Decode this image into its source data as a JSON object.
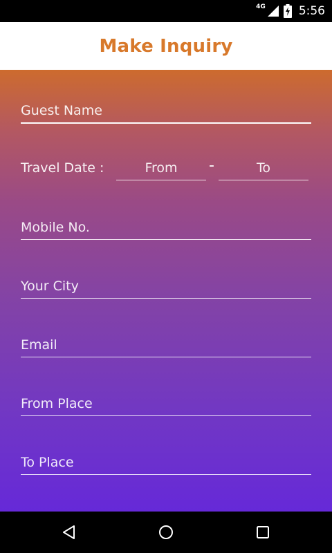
{
  "status_bar": {
    "network": "4G",
    "time": "5:56",
    "icons": [
      "signal-icon",
      "battery-charging-icon"
    ]
  },
  "header": {
    "title": "Make Inquiry",
    "title_color": "#d8792b"
  },
  "form": {
    "guest_name": {
      "placeholder": "Guest Name"
    },
    "travel_date": {
      "label": "Travel Date :",
      "from_placeholder": "From",
      "separator": "-",
      "to_placeholder": "To"
    },
    "mobile": {
      "placeholder": "Mobile No."
    },
    "city": {
      "placeholder": "Your City"
    },
    "email": {
      "placeholder": "Email"
    },
    "from_place": {
      "placeholder": "From Place"
    },
    "to_place": {
      "placeholder": "To Place"
    }
  },
  "nav_bar": {
    "icons": [
      "back-icon",
      "home-icon",
      "recents-icon"
    ]
  },
  "colors": {
    "gradient_top": "#cd6b2e",
    "gradient_bottom": "#6629d8"
  }
}
